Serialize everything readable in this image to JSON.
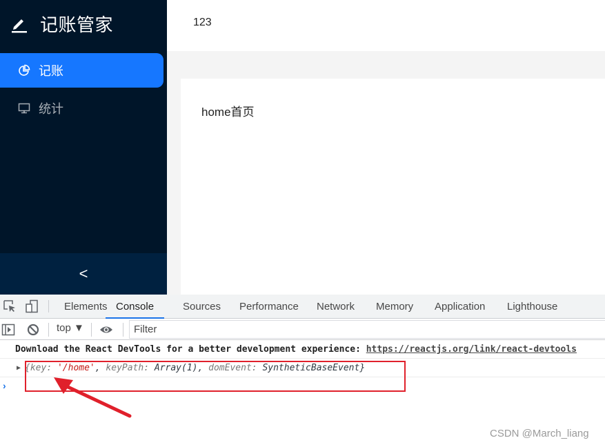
{
  "app": {
    "logo_text": "记账管家",
    "logo_icon": "edit-pen-icon",
    "menu": [
      {
        "label": "记账",
        "icon": "pie-chart-icon",
        "active": true
      },
      {
        "label": "统计",
        "icon": "desktop-icon",
        "active": false
      }
    ],
    "collapse_trigger": "<",
    "header_text": "123",
    "content_text": "home首页"
  },
  "devtools": {
    "tabs": [
      "Elements",
      "Console",
      "Sources",
      "Performance",
      "Network",
      "Memory",
      "Application",
      "Lighthouse"
    ],
    "active_tab": "Console",
    "context": "top ▼",
    "filter_placeholder": "Filter",
    "console": {
      "message1_text": "Download the React DevTools for a better development experience: ",
      "message1_link": "https://reactjs.org/link/react-devtools",
      "log": {
        "open_brace": "{",
        "key_label": "key",
        "key_value": "'/home'",
        "keypath_label": "keyPath",
        "keypath_value": "Array(1)",
        "domevent_label": "domEvent",
        "domevent_value": "SyntheticBaseEvent",
        "close_brace": "}"
      },
      "prompt": "›"
    }
  },
  "annotation": {
    "color": "#e0202b"
  },
  "watermark": "CSDN @March_liang"
}
